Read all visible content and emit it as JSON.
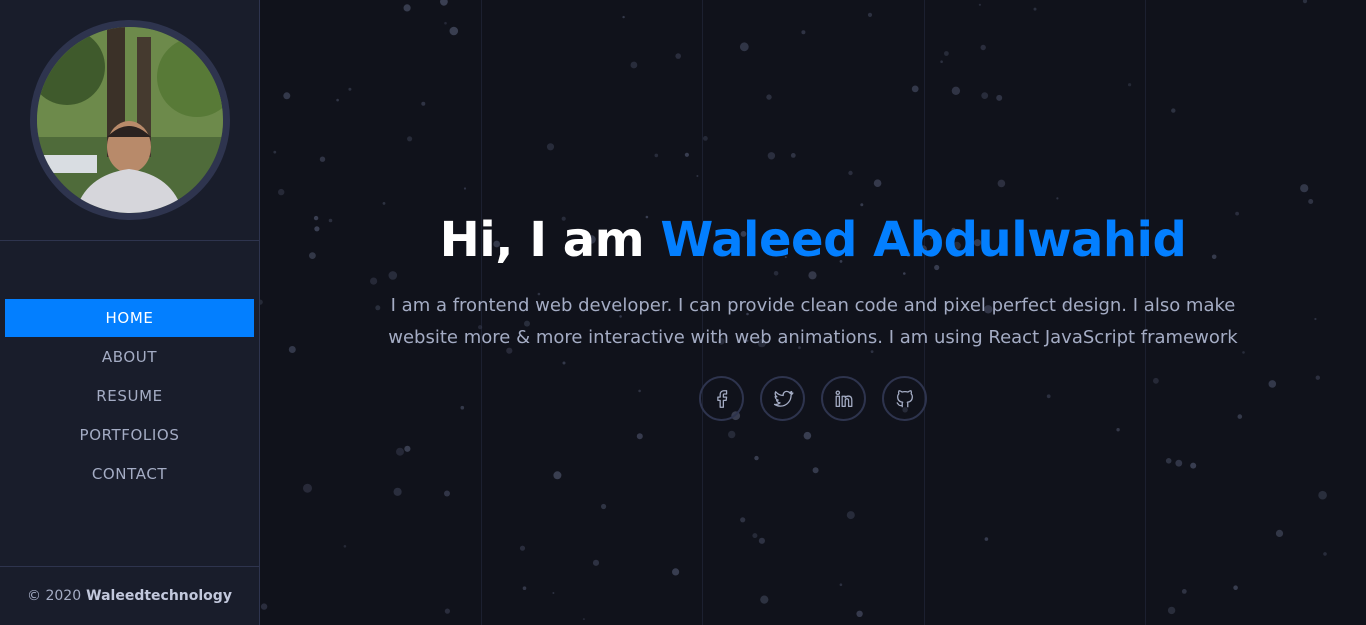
{
  "sidebar": {
    "nav": [
      {
        "label": "HOME",
        "active": true
      },
      {
        "label": "ABOUT",
        "active": false
      },
      {
        "label": "RESUME",
        "active": false
      },
      {
        "label": "PORTFOLIOS",
        "active": false
      },
      {
        "label": "CONTACT",
        "active": false
      }
    ],
    "footer": {
      "copyright": "© 2020",
      "brand": "Waleedtechnology"
    }
  },
  "hero": {
    "greeting": "Hi, I am",
    "name": "Waleed Abdulwahid",
    "description": "I am a frontend web developer. I can provide clean code and pixel perfect design. I also make website more & more interactive with web animations. I am using React JavaScript framework",
    "socials": [
      {
        "icon": "facebook-icon"
      },
      {
        "icon": "twitter-icon"
      },
      {
        "icon": "linkedin-icon"
      },
      {
        "icon": "github-icon"
      }
    ]
  },
  "colors": {
    "accent": "#037fff",
    "sidebar_bg": "#191d2b",
    "body_bg": "#10121b",
    "border": "#2e344e",
    "text": "#a4acc4"
  }
}
